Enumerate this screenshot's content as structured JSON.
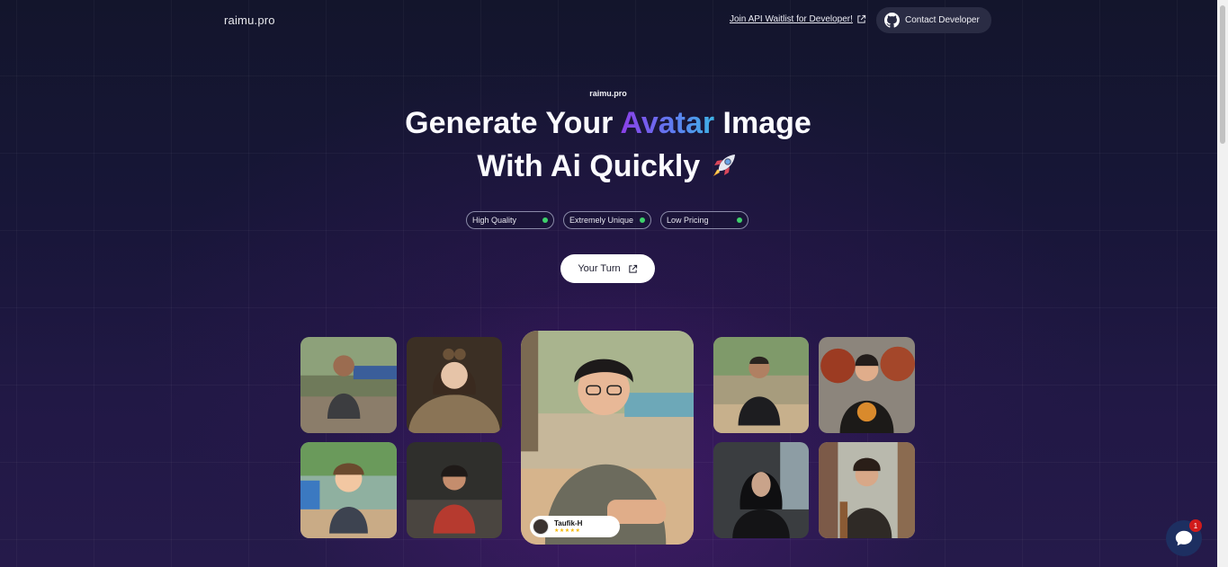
{
  "header": {
    "brand": "raimu.pro",
    "waitlist_link": "Join API Waitlist for Developer!",
    "contact_button": "Contact Developer"
  },
  "hero": {
    "eyebrow": "raimu.pro",
    "title_part1": "Generate Your ",
    "title_accent": "Avatar",
    "title_part2": " Image",
    "title_line2": "With Ai Quickly",
    "emoji_icon": "rocket-icon"
  },
  "features": [
    {
      "label": "High Quality"
    },
    {
      "label": "Extremely Unique"
    },
    {
      "label": "Low Pricing"
    }
  ],
  "cta": {
    "label": "Your Turn"
  },
  "review_card": {
    "name": "Taufik-H",
    "rating": 5,
    "stars": "★★★★★"
  },
  "chat_widget": {
    "badge_count": "1"
  },
  "colors": {
    "accent_start": "#8b3fe8",
    "accent_end": "#3fb3e6",
    "status_dot": "#3ed16b"
  }
}
